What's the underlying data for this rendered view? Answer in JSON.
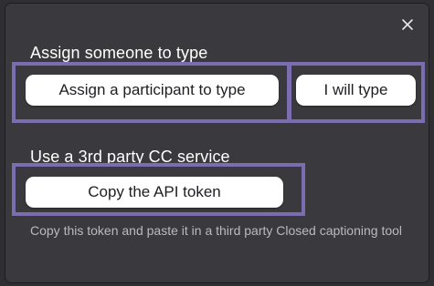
{
  "dialog": {
    "close_icon": "close-icon",
    "section_assign": {
      "title": "Assign someone to type",
      "assign_participant_label": "Assign a participant to type",
      "self_type_label": "I will type"
    },
    "section_third_party": {
      "title": "Use a 3rd party CC service",
      "copy_token_label": "Copy the API token",
      "description": "Copy this token and paste it in a third party Closed captioning tool"
    }
  },
  "colors": {
    "panel_bg": "#3a3a3e",
    "highlight": "#7c6cb0",
    "button_bg": "#ffffff",
    "description_text": "#b9b9bf"
  }
}
